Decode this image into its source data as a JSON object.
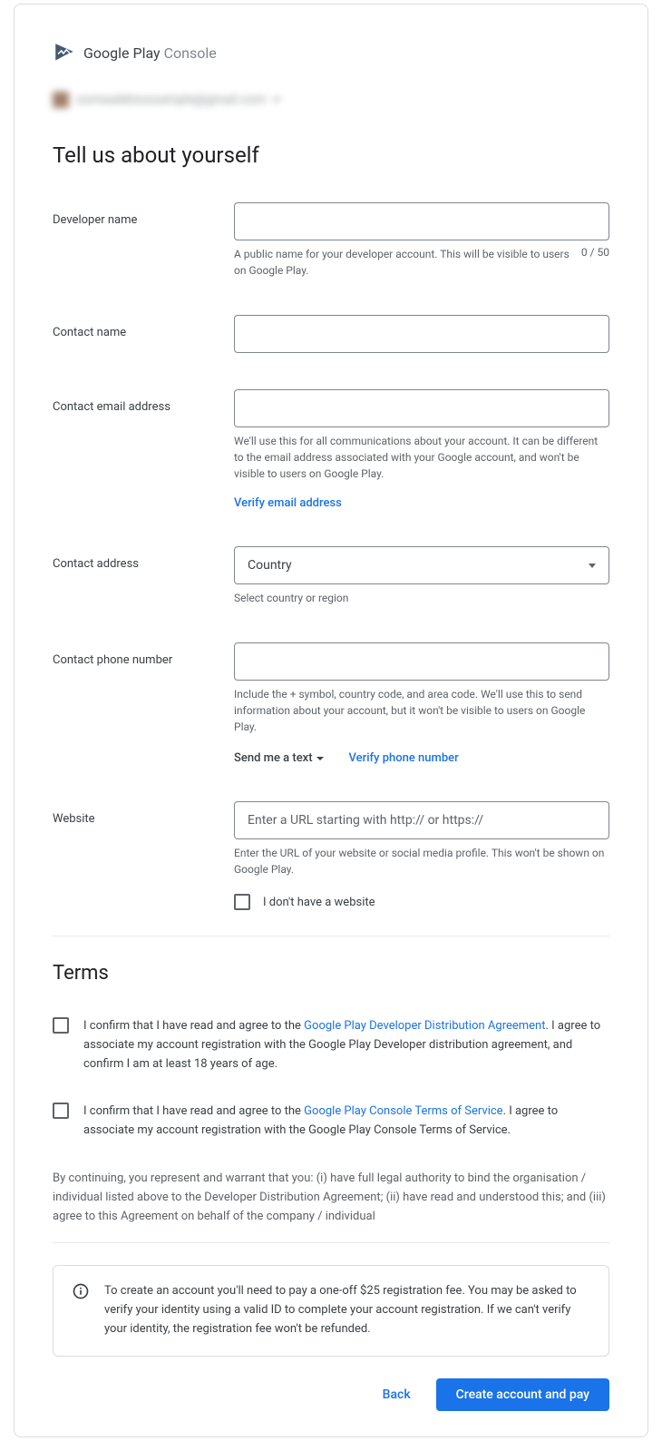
{
  "brand": {
    "name1": "Google Play",
    "name2": " Console"
  },
  "account": {
    "email": "someaddresssample@gmail.com"
  },
  "heading": "Tell us about yourself",
  "fields": {
    "devname": {
      "label": "Developer name",
      "helper": "A public name for your developer account. This will be visible to users on Google Play.",
      "counter": "0 / 50"
    },
    "contactname": {
      "label": "Contact name"
    },
    "email": {
      "label": "Contact email address",
      "helper": "We'll use this for all communications about your account. It can be different to the email address associated with your Google account, and won't be visible to users on Google Play.",
      "verify": "Verify email address"
    },
    "address": {
      "label": "Contact address",
      "select": "Country",
      "helper": "Select country or region"
    },
    "phone": {
      "label": "Contact phone number",
      "helper": "Include the + symbol, country code, and area code. We'll use this to send information about your account, but it won't be visible to users on Google Play.",
      "sendtext": "Send me a text",
      "verify": "Verify phone number"
    },
    "website": {
      "label": "Website",
      "placeholder": "Enter a URL starting with http:// or https://",
      "helper": "Enter the URL of your website or social media profile. This won't be shown on Google Play.",
      "nowebsite": "I don't have a website"
    }
  },
  "terms": {
    "heading": "Terms",
    "t1_a": "I confirm that I have read and agree to the ",
    "t1_link": "Google Play Developer Distribution Agreement",
    "t1_b": ". I agree to associate my account registration with the Google Play Developer distribution agreement, and confirm I am at least 18 years of age.",
    "t2_a": "I confirm that I have read and agree to the ",
    "t2_link": "Google Play Console Terms of Service",
    "t2_b": ". I agree to associate my account registration with the Google Play Console Terms of Service.",
    "legal": "By continuing, you represent and warrant that you: (i) have full legal authority to bind the organisation / individual listed above to the Developer Distribution Agreement; (ii) have read and understood this; and (iii) agree to this Agreement on behalf of the company / individual"
  },
  "info": "To create an account you'll need to pay a one-off $25 registration fee. You may be asked to verify your identity using a valid ID to complete your account registration. If we can't verify your identity, the registration fee won't be refunded.",
  "footer": {
    "back": "Back",
    "submit": "Create account and pay"
  }
}
